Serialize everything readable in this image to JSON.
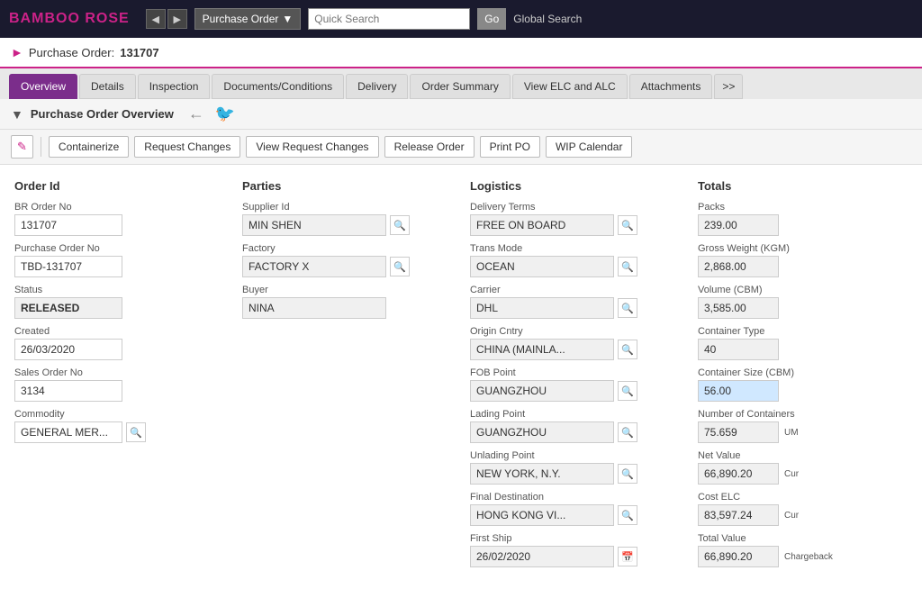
{
  "brand": "BAMBOO ROSE",
  "topNav": {
    "navType": "Purchase Order",
    "searchPlaceholder": "Quick Search",
    "goLabel": "Go",
    "globalSearchLabel": "Global Search"
  },
  "breadcrumb": {
    "label": "Purchase Order:",
    "id": "131707"
  },
  "tabs": [
    {
      "label": "Overview",
      "active": true
    },
    {
      "label": "Details",
      "active": false
    },
    {
      "label": "Inspection",
      "active": false
    },
    {
      "label": "Documents/Conditions",
      "active": false
    },
    {
      "label": "Delivery",
      "active": false
    },
    {
      "label": "Order Summary",
      "active": false
    },
    {
      "label": "View ELC and ALC",
      "active": false
    },
    {
      "label": "Attachments",
      "active": false
    },
    {
      "label": ">>",
      "active": false
    }
  ],
  "sectionHeader": {
    "title": "Purchase Order Overview",
    "arrow": "▼"
  },
  "toolbar": {
    "editIcon": "✎",
    "buttons": [
      "Containerize",
      "Request Changes",
      "View Request Changes",
      "Release Order",
      "Print PO",
      "WIP Calendar"
    ]
  },
  "orderSection": {
    "title": "Order Id",
    "fields": [
      {
        "label": "BR Order No",
        "value": "131707",
        "white": true
      },
      {
        "label": "Purchase Order No",
        "value": "TBD-131707",
        "white": true
      },
      {
        "label": "Status",
        "value": "RELEASED",
        "white": false
      },
      {
        "label": "Created",
        "value": "26/03/2020",
        "white": true
      },
      {
        "label": "Sales Order No",
        "value": "3134",
        "white": true
      },
      {
        "label": "Commodity",
        "value": "GENERAL MER...",
        "white": true,
        "hasSearch": true
      }
    ]
  },
  "partiesSection": {
    "title": "Parties",
    "fields": [
      {
        "label": "Supplier Id",
        "value": "MIN SHEN",
        "hasSearch": true
      },
      {
        "label": "Factory",
        "value": "FACTORY X",
        "hasSearch": true
      },
      {
        "label": "Buyer",
        "value": "NINA",
        "hasSearch": false
      }
    ]
  },
  "logisticsSection": {
    "title": "Logistics",
    "fields": [
      {
        "label": "Delivery Terms",
        "value": "FREE ON BOARD",
        "hasSearch": true
      },
      {
        "label": "Trans Mode",
        "value": "OCEAN",
        "hasSearch": true
      },
      {
        "label": "Carrier",
        "value": "DHL",
        "hasSearch": true
      },
      {
        "label": "Origin Cntry",
        "value": "CHINA (MAINLA...",
        "hasSearch": true
      },
      {
        "label": "FOB Point",
        "value": "GUANGZHOU",
        "hasSearch": true
      },
      {
        "label": "Lading Point",
        "value": "GUANGZHOU",
        "hasSearch": true
      },
      {
        "label": "Unlading Point",
        "value": "NEW YORK, N.Y.",
        "hasSearch": true
      },
      {
        "label": "Final Destination",
        "value": "HONG KONG VI...",
        "hasSearch": true
      },
      {
        "label": "First Ship",
        "value": "26/02/2020",
        "hasSearch": false,
        "hasCalendar": true
      }
    ]
  },
  "totalsSection": {
    "title": "Totals",
    "fields": [
      {
        "label": "Packs",
        "value": "239.00"
      },
      {
        "label": "Gross Weight (KGM)",
        "value": "2,868.00"
      },
      {
        "label": "Volume (CBM)",
        "value": "3,585.00"
      },
      {
        "label": "Container Type",
        "value": "40"
      },
      {
        "label": "Container Size (CBM)",
        "value": "56.00"
      },
      {
        "label": "Number of Containers",
        "value": "75.659",
        "suffix": "UM"
      },
      {
        "label": "Net Value",
        "value": "66,890.20",
        "suffix": "Cur"
      },
      {
        "label": "Cost ELC",
        "value": "83,597.24",
        "suffix": "Cur"
      },
      {
        "label": "Total Value",
        "value": "66,890.20",
        "suffix": "Chargeback"
      }
    ]
  }
}
